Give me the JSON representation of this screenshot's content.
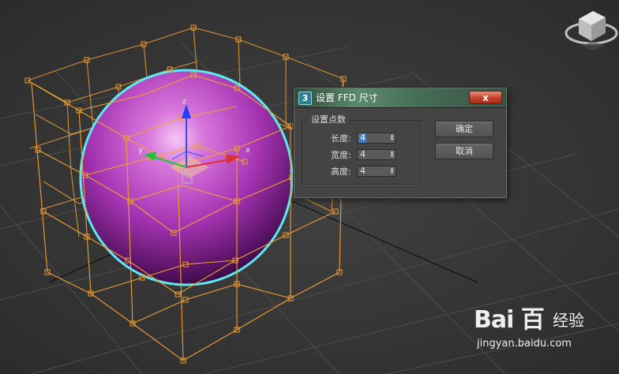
{
  "dialog": {
    "title": "设置 FFD 尺寸",
    "app_icon_label": "3",
    "close_label": "x",
    "group_label": "设置点数",
    "fields": [
      {
        "label": "长度:",
        "value": "4"
      },
      {
        "label": "宽度:",
        "value": "4"
      },
      {
        "label": "高度:",
        "value": "4"
      }
    ],
    "ok_label": "确定",
    "cancel_label": "取消"
  },
  "viewport": {
    "axis_x_label": "x",
    "axis_y_label": "y",
    "axis_z_label": "z",
    "colors": {
      "background": "#3a3a3a",
      "lattice": "#f0a030",
      "sphere": "#b040c0",
      "selection_outline": "#5ee8f0"
    }
  },
  "watermark": {
    "logo": "Bai 百",
    "sub": "经验",
    "url": "jingyan.baidu.com"
  }
}
